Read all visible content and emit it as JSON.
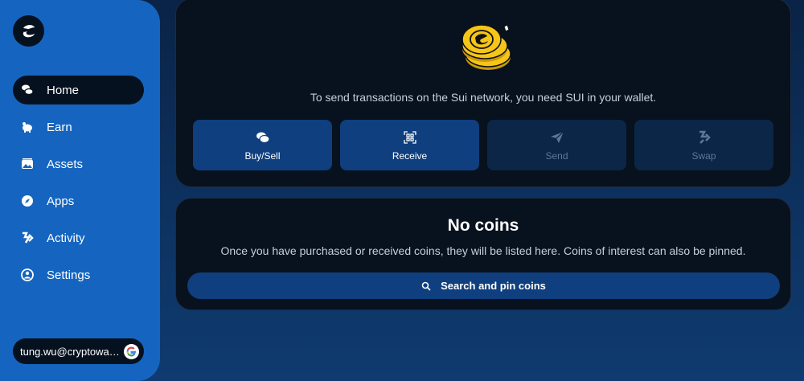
{
  "sidebar": {
    "logo_icon": "sui-wallet-logo",
    "items": [
      {
        "label": "Home",
        "icon": "home-icon",
        "active": true
      },
      {
        "label": "Earn",
        "icon": "piggy-bank-icon",
        "active": false
      },
      {
        "label": "Assets",
        "icon": "image-icon",
        "active": false
      },
      {
        "label": "Apps",
        "icon": "compass-icon",
        "active": false
      },
      {
        "label": "Activity",
        "icon": "activity-icon",
        "active": false
      },
      {
        "label": "Settings",
        "icon": "settings-icon",
        "active": false
      }
    ],
    "account": {
      "email": "tung.wu@cryptowallet.com",
      "provider_icon": "google-icon"
    }
  },
  "main": {
    "info_text": "To send transactions on the Sui network, you need SUI in your wallet.",
    "actions": [
      {
        "label": "Buy/Sell",
        "icon": "coin-icon",
        "enabled": true
      },
      {
        "label": "Receive",
        "icon": "qr-code-icon",
        "enabled": true
      },
      {
        "label": "Send",
        "icon": "send-icon",
        "enabled": false
      },
      {
        "label": "Swap",
        "icon": "swap-icon",
        "enabled": false
      }
    ],
    "coins": {
      "title": "No coins",
      "description": "Once you have purchased or received coins, they will be listed here. Coins of interest can also be pinned.",
      "search_label": "Search and pin coins"
    }
  },
  "colors": {
    "sidebar": "#1565c0",
    "card": "#08111e",
    "button_enabled": "#0f3f7e",
    "button_disabled": "#0b2647",
    "coin_gold": "#f5c518"
  }
}
